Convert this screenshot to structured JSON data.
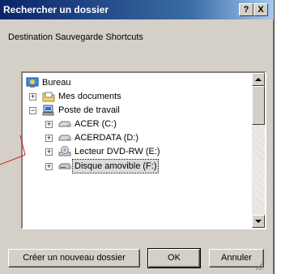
{
  "window": {
    "title": "Rechercher un dossier",
    "help_label": "?",
    "close_label": "X"
  },
  "description": "Destination Sauvegarde Shortcuts",
  "tree": {
    "items": [
      {
        "label": "Bureau",
        "icon": "desktop-icon"
      },
      {
        "label": "Mes documents",
        "icon": "folder-icon",
        "expander": "+"
      },
      {
        "label": "Poste de travail",
        "icon": "computer-icon",
        "expander": "−"
      },
      {
        "label": "ACER (C:)",
        "icon": "drive-icon",
        "expander": "+"
      },
      {
        "label": "ACERDATA (D:)",
        "icon": "drive-icon",
        "expander": "+"
      },
      {
        "label": "Lecteur DVD-RW (E:)",
        "icon": "dvd-drive-icon",
        "expander": "+"
      },
      {
        "label": "Disque amovible (F:)",
        "icon": "removable-drive-icon",
        "expander": "+",
        "selected": true
      }
    ]
  },
  "buttons": {
    "new_folder": "Créer un nouveau dossier",
    "ok": "OK",
    "cancel": "Annuler"
  },
  "colors": {
    "titlebar_start": "#0a246a",
    "titlebar_end": "#a6caf0",
    "dialog_bg": "#d4d0c8",
    "annotation": "#d42020"
  }
}
